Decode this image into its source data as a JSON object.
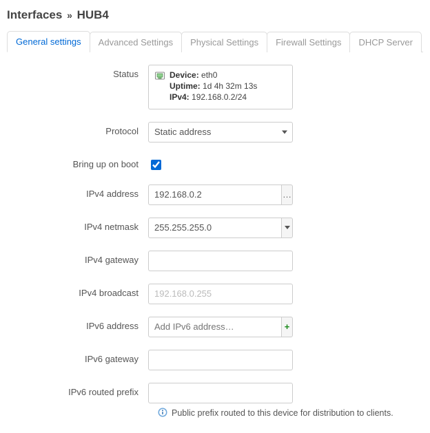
{
  "title": {
    "section": "Interfaces",
    "name": "HUB4"
  },
  "tabs": [
    {
      "label": "General settings",
      "active": true
    },
    {
      "label": "Advanced Settings",
      "active": false
    },
    {
      "label": "Physical Settings",
      "active": false
    },
    {
      "label": "Firewall Settings",
      "active": false
    },
    {
      "label": "DHCP Server",
      "active": false
    }
  ],
  "fields": {
    "status": {
      "label": "Status",
      "device_label": "Device:",
      "device_value": "eth0",
      "uptime_label": "Uptime:",
      "uptime_value": "1d 4h 32m 13s",
      "ipv4_label": "IPv4:",
      "ipv4_value": "192.168.0.2/24"
    },
    "protocol": {
      "label": "Protocol",
      "value": "Static address"
    },
    "bring_up": {
      "label": "Bring up on boot",
      "checked": true
    },
    "ipv4_addr": {
      "label": "IPv4 address",
      "value": "192.168.0.2",
      "more": "…"
    },
    "ipv4_mask": {
      "label": "IPv4 netmask",
      "value": "255.255.255.0"
    },
    "ipv4_gw": {
      "label": "IPv4 gateway",
      "value": ""
    },
    "ipv4_bc": {
      "label": "IPv4 broadcast",
      "value": "",
      "placeholder": "192.168.0.255"
    },
    "ipv6_addr": {
      "label": "IPv6 address",
      "placeholder": "Add IPv6 address…",
      "add": "+"
    },
    "ipv6_gw": {
      "label": "IPv6 gateway",
      "value": ""
    },
    "ipv6_prefix": {
      "label": "IPv6 routed prefix",
      "value": ""
    }
  },
  "hint": "Public prefix routed to this device for distribution to clients."
}
